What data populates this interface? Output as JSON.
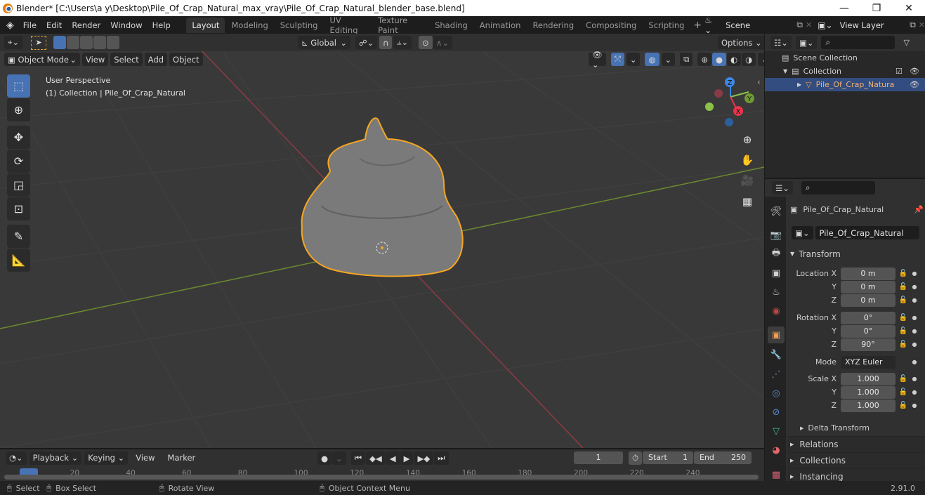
{
  "window": {
    "title": "Blender* [C:\\Users\\a y\\Desktop\\Pile_Of_Crap_Natural_max_vray\\Pile_Of_Crap_Natural_blender_base.blend]",
    "minimize": "—",
    "maximize": "❐",
    "close": "✕"
  },
  "menus": [
    "File",
    "Edit",
    "Render",
    "Window",
    "Help"
  ],
  "workspaces": [
    "Layout",
    "Modeling",
    "Sculpting",
    "UV Editing",
    "Texture Paint",
    "Shading",
    "Animation",
    "Rendering",
    "Compositing",
    "Scripting"
  ],
  "active_workspace": "Layout",
  "scene": {
    "label": "Scene",
    "view_layer": "View Layer"
  },
  "header": {
    "transform_orientation": "Global",
    "options": "Options",
    "mode": "Object Mode",
    "view_menus": [
      "View",
      "Select",
      "Add",
      "Object"
    ]
  },
  "viewport": {
    "perspective": "User Perspective",
    "collection_info": "(1) Collection | Pile_Of_Crap_Natural",
    "gizmo": {
      "x": "X",
      "y": "Y",
      "z": "Z"
    }
  },
  "outliner": {
    "scene_collection": "Scene Collection",
    "collection": "Collection",
    "object": "Pile_Of_Crap_Natura"
  },
  "properties": {
    "object_name": "Pile_Of_Crap_Natural",
    "data_name": "Pile_Of_Crap_Natural",
    "transform_label": "Transform",
    "location": {
      "label": "Location X",
      "x": "0 m",
      "y": "0 m",
      "z": "0 m"
    },
    "rotation": {
      "label": "Rotation X",
      "x": "0°",
      "y": "0°",
      "z": "90°"
    },
    "mode": {
      "label": "Mode",
      "value": "XYZ Euler"
    },
    "scale": {
      "label": "Scale X",
      "x": "1.000",
      "y": "1.000",
      "z": "1.000"
    },
    "axis_y": "Y",
    "axis_z": "Z",
    "subpanels": [
      "Delta Transform"
    ],
    "panels": [
      "Relations",
      "Collections",
      "Instancing"
    ]
  },
  "timeline": {
    "menus": [
      "Playback",
      "Keying",
      "View",
      "Marker"
    ],
    "current_frame": "1",
    "start_label": "Start",
    "start": "1",
    "end_label": "End",
    "end": "250",
    "ticks": [
      "1",
      "20",
      "40",
      "60",
      "80",
      "100",
      "120",
      "140",
      "160",
      "180",
      "200",
      "220",
      "240"
    ]
  },
  "statusbar": {
    "select": "Select",
    "box_select": "Box Select",
    "rotate_view": "Rotate View",
    "context_menu": "Object Context Menu",
    "version": "2.91.0"
  },
  "colors": {
    "accent": "#4772b3",
    "selection_outline": "#f5a623",
    "x_axis": "#e8354b",
    "y_axis": "#8bc34a",
    "z_axis": "#3d87e6"
  }
}
